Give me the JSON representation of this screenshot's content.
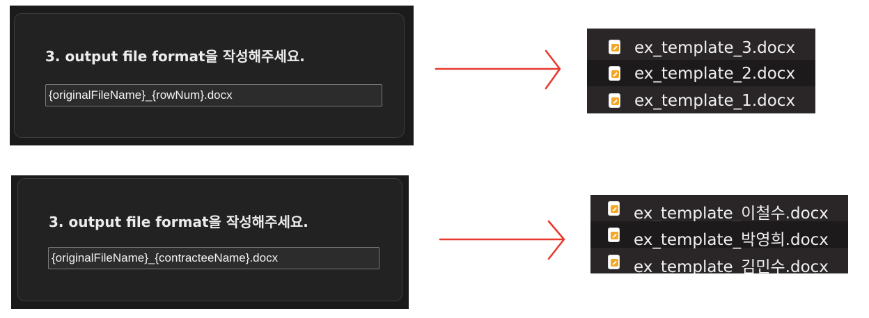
{
  "examples": [
    {
      "prompt": "3. output file format을 작성해주세요.",
      "format_value": "{originalFileName}_{rowNum}.docx",
      "files": [
        "ex_template_3.docx",
        "ex_template_2.docx",
        "ex_template_1.docx"
      ]
    },
    {
      "prompt": "3. output file format을 작성해주세요.",
      "format_value": "{originalFileName}_{contracteeName}.docx",
      "files": [
        "ex_template_이철수.docx",
        "ex_template_박영희.docx",
        "ex_template_김민수.docx"
      ]
    }
  ],
  "colors": {
    "arrow": "#e8392f",
    "file_badge": "#f5a623"
  },
  "icons": {
    "file": "pages-document-icon",
    "arrow": "right-arrow-icon"
  }
}
